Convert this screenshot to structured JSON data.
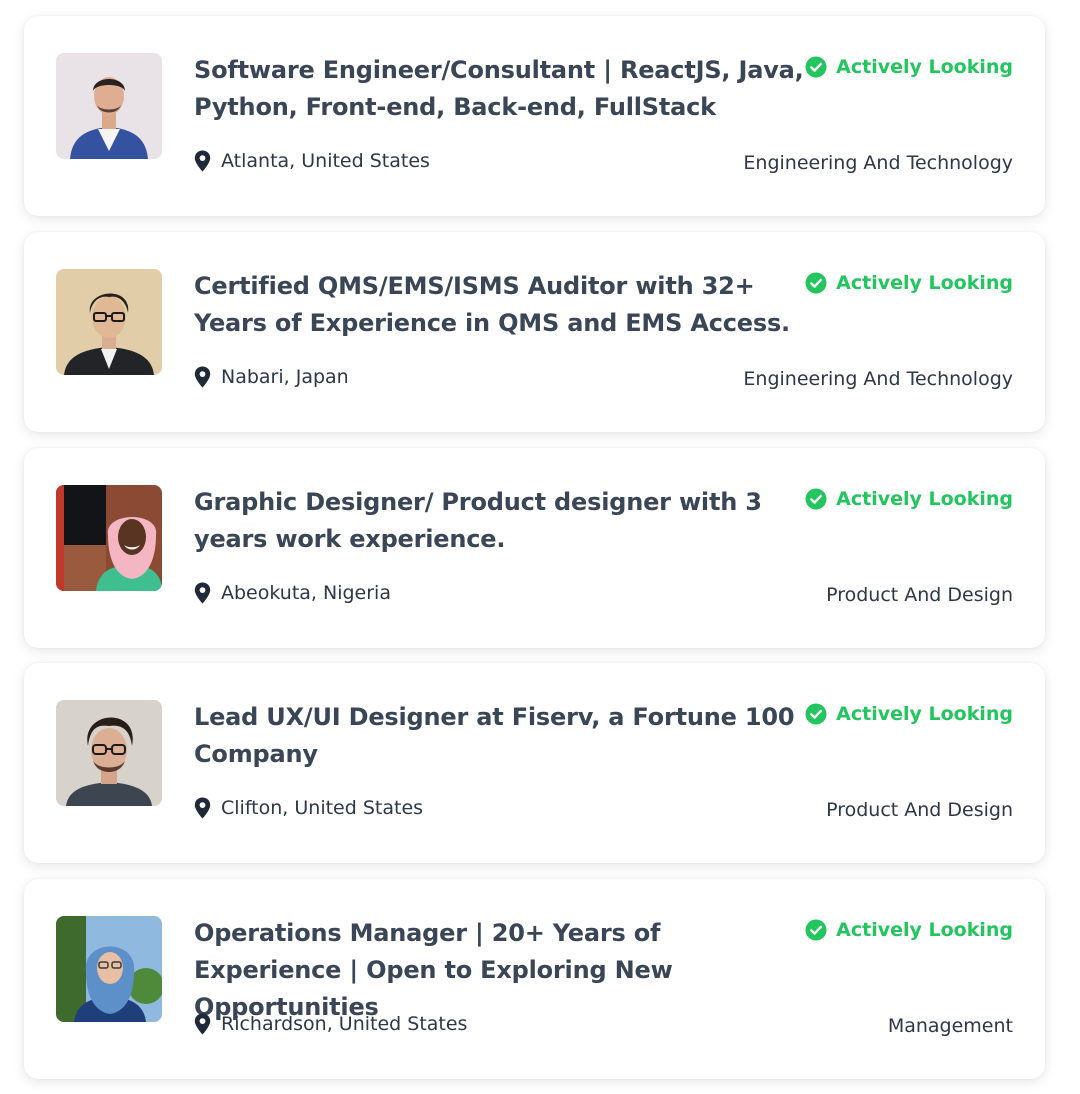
{
  "colors": {
    "accent_green": "#22c55e",
    "title_text": "#3a4556",
    "body_text": "#2d3748",
    "card_background": "#ffffff"
  },
  "candidates": [
    {
      "title": "Software Engineer/Consultant | ReactJS, Java, Python, Front-end, Back-end, FullStack",
      "status": "Actively Looking",
      "location": "Atlanta, United States",
      "category": "Engineering And Technology",
      "avatar_icon": "man-in-blue-suit-photo"
    },
    {
      "title": "Certified QMS/EMS/ISMS Auditor with 32+ Years of Experience in QMS and EMS Access.",
      "status": "Actively Looking",
      "location": "Nabari, Japan",
      "category": "Engineering And Technology",
      "avatar_icon": "man-with-glasses-photo"
    },
    {
      "title": "Graphic Designer/ Product designer with 3 years work experience.",
      "status": "Actively Looking",
      "location": "Abeokuta, Nigeria",
      "category": "Product And Design",
      "avatar_icon": "woman-in-pink-hijab-photo"
    },
    {
      "title": "Lead UX/UI Designer at Fiserv, a Fortune 100 Company",
      "status": "Actively Looking",
      "location": "Clifton, United States",
      "category": "Product And Design",
      "avatar_icon": "man-with-curly-hair-photo"
    },
    {
      "title": "Operations Manager | 20+ Years of Experience | Open to Exploring New Opportunities",
      "status": "Actively Looking",
      "location": "Richardson, United States",
      "category": "Management",
      "avatar_icon": "woman-in-blue-hijab-photo"
    }
  ]
}
